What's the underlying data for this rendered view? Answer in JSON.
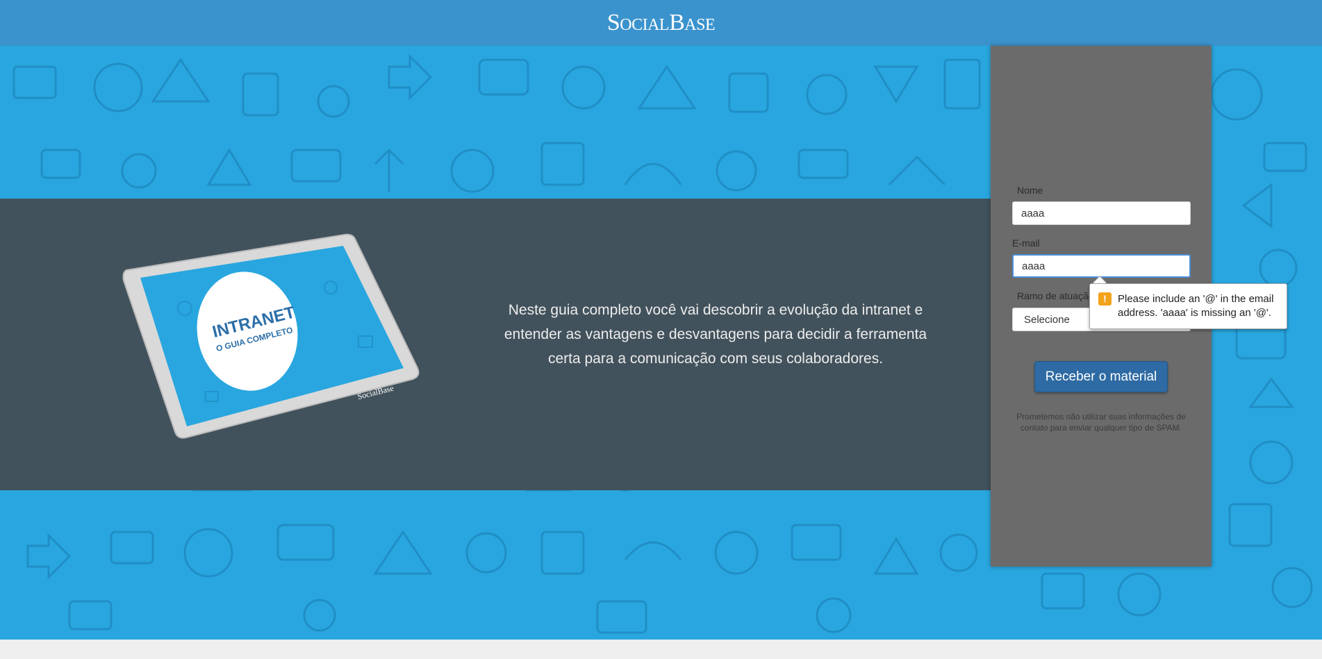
{
  "header": {
    "logo_text": "SocialBase"
  },
  "hero": {
    "description": "Neste guia completo você vai descobrir a evolução da intranet e entender as vantagens e desvantagens para decidir a ferramenta certa para a comunicação com seus colaboradores.",
    "ebook_cover": {
      "title": "INTRANET",
      "subtitle": "O GUIA COMPLETO",
      "brand": "SocialBase"
    }
  },
  "form": {
    "name_label": "Nome",
    "name_value": "aaaa",
    "email_label": "E-mail",
    "email_value": "aaaa",
    "industry_label": "Ramo de atuação",
    "industry_selected": "Selecione",
    "submit_label": "Receber o material",
    "disclaimer": "Prometemos não utilizar suas informações de contato para enviar qualquer tipo de SPAM."
  },
  "validation_tooltip": {
    "icon": "warning-icon",
    "message": "Please include an '@' in the email address. 'aaaa' is missing an '@'."
  },
  "colors": {
    "header_bg": "#3b93cd",
    "pattern_bg": "#29a6df",
    "band_bg": "#434f58",
    "panel_bg": "#6b6b6b",
    "button_bg": "#2e6aa3",
    "warning": "#f3a31b"
  }
}
